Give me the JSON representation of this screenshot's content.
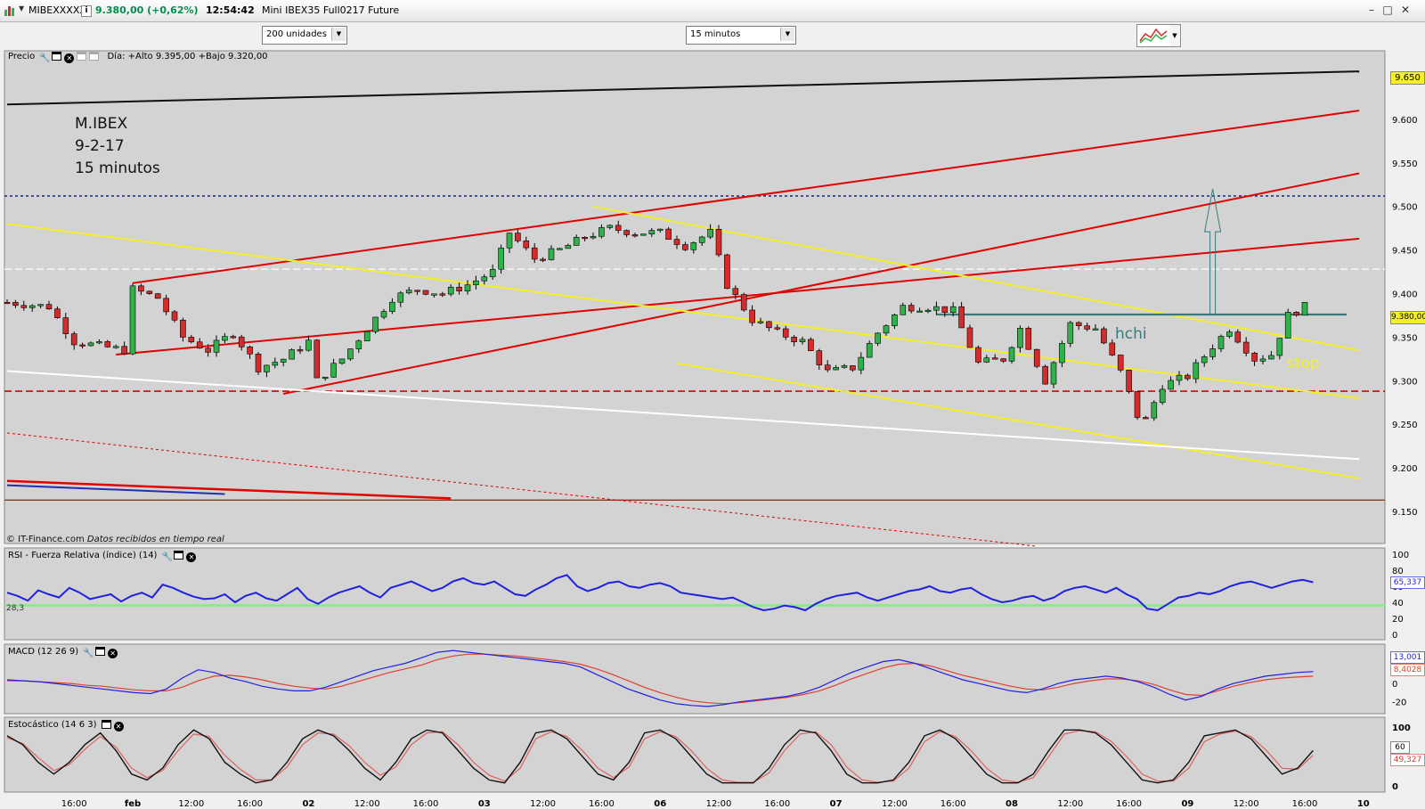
{
  "window": {
    "symbol": "MIBEXXXXX",
    "info_label": "i",
    "price_change": "9.380,00 (+0,62%)",
    "time": "12:54:42",
    "description": "Mini IBEX35 Full0217 Future"
  },
  "toolbar": {
    "units_value": "200 unidades",
    "interval_value": "15 minutos"
  },
  "price_panel": {
    "label": "Precio",
    "ohlc_text": "Día: +Alto 9.395,00 +Bajo 9.320,00",
    "annotation_lines": [
      "M.IBEX",
      "9-2-17",
      "15 minutos"
    ],
    "hchi_label": "hchi",
    "stop_label": "stop",
    "copyright": "© IT-Finance.com",
    "realtime_note": "Datos recibidos en tiempo real",
    "last_price_tag": "9.380,00",
    "top_price_tag": "9.650"
  },
  "rsi_panel": {
    "label": "RSI - Fuerza Relativa (índice) (14)",
    "min_value_label": "28,3",
    "value_tag": "65,337"
  },
  "macd_panel": {
    "label": "MACD (12 26 9)",
    "value_tag_1": "13,001",
    "value_tag_2": "8,4028"
  },
  "stoch_panel": {
    "label": "Estocástico (14 6 3)",
    "value_tag_1": "60",
    "value_tag_2": "49,327"
  },
  "colors": {
    "bull": "#2fb24a",
    "bear": "#d62b2b",
    "channel": "#e10000",
    "trend_yellow": "#f4ef2a",
    "rsi": "#2020e0",
    "macd": "#2020e0",
    "signal": "#e04030",
    "hchi_line": "#3b7a7a",
    "panel_bg": "#d3d3d3"
  },
  "chart_data": [
    {
      "type": "candlestick",
      "ylim": [
        9150,
        9650
      ],
      "y_ticks": [
        "9.650",
        "9.600",
        "9.550",
        "9.500",
        "9.450",
        "9.400",
        "9.350",
        "9.300",
        "9.250",
        "9.200",
        "9.150"
      ],
      "y_tick_values": [
        9650,
        9600,
        9550,
        9500,
        9450,
        9400,
        9350,
        9300,
        9250,
        9200,
        9150
      ],
      "x_ticks": [
        "16:00",
        "feb",
        "12:00",
        "16:00",
        "02",
        "12:00",
        "16:00",
        "03",
        "12:00",
        "16:00",
        "06",
        "12:00",
        "16:00",
        "07",
        "12:00",
        "16:00",
        "08",
        "12:00",
        "16:00",
        "09",
        "12:00",
        "16:00",
        "10"
      ],
      "x_tick_bars": [
        8,
        15,
        22,
        29,
        36,
        43,
        50,
        57,
        64,
        71,
        78,
        85,
        92,
        99,
        106,
        113,
        120,
        127,
        134,
        141,
        148,
        155,
        162
      ],
      "n_bars": 165,
      "path_points": [
        [
          0,
          9390
        ],
        [
          5,
          9385
        ],
        [
          8,
          9345
        ],
        [
          11,
          9340
        ],
        [
          14,
          9335
        ],
        [
          15,
          9405
        ],
        [
          18,
          9395
        ],
        [
          21,
          9350
        ],
        [
          24,
          9335
        ],
        [
          27,
          9355
        ],
        [
          30,
          9315
        ],
        [
          33,
          9325
        ],
        [
          36,
          9345
        ],
        [
          37,
          9300
        ],
        [
          40,
          9325
        ],
        [
          43,
          9360
        ],
        [
          46,
          9395
        ],
        [
          49,
          9405
        ],
        [
          52,
          9400
        ],
        [
          55,
          9410
        ],
        [
          58,
          9425
        ],
        [
          60,
          9470
        ],
        [
          63,
          9440
        ],
        [
          66,
          9450
        ],
        [
          69,
          9465
        ],
        [
          72,
          9475
        ],
        [
          75,
          9470
        ],
        [
          78,
          9470
        ],
        [
          81,
          9455
        ],
        [
          84,
          9470
        ],
        [
          86,
          9410
        ],
        [
          89,
          9370
        ],
        [
          92,
          9355
        ],
        [
          95,
          9345
        ],
        [
          98,
          9310
        ],
        [
          101,
          9315
        ],
        [
          104,
          9355
        ],
        [
          107,
          9385
        ],
        [
          110,
          9385
        ],
        [
          113,
          9380
        ],
        [
          116,
          9320
        ],
        [
          119,
          9325
        ],
        [
          121,
          9360
        ],
        [
          124,
          9300
        ],
        [
          127,
          9365
        ],
        [
          130,
          9360
        ],
        [
          133,
          9310
        ],
        [
          135,
          9260
        ],
        [
          136,
          9255
        ],
        [
          138,
          9295
        ],
        [
          141,
          9305
        ],
        [
          144,
          9340
        ],
        [
          146,
          9360
        ],
        [
          149,
          9325
        ],
        [
          151,
          9330
        ],
        [
          153,
          9375
        ],
        [
          155,
          9385
        ]
      ],
      "hlines": [
        {
          "value": 9512,
          "style": "blue-dotted"
        },
        {
          "value": 9288,
          "style": "red-dashed"
        },
        {
          "value": 9428,
          "style": "white-dashed"
        },
        {
          "value": 9163,
          "style": "brown"
        }
      ],
      "hchi_level": 9376,
      "target_arrow": {
        "from": 9376,
        "to": 9520
      }
    },
    {
      "type": "line",
      "name_label": "RSI",
      "ylim": [
        0,
        100
      ],
      "y_ticks": [
        "100",
        "80",
        "60",
        "40",
        "20",
        "0"
      ],
      "y_tick_values": [
        100,
        80,
        60,
        40,
        20,
        0
      ],
      "reference_level": 28.3,
      "values": [
        52,
        48,
        42,
        55,
        50,
        46,
        58,
        52,
        44,
        47,
        50,
        41,
        48,
        52,
        46,
        62,
        58,
        52,
        47,
        44,
        45,
        50,
        40,
        48,
        52,
        45,
        42,
        50,
        58,
        44,
        38,
        46,
        52,
        56,
        60,
        52,
        46,
        58,
        62,
        66,
        60,
        54,
        58,
        66,
        70,
        64,
        62,
        66,
        58,
        50,
        48,
        56,
        62,
        70,
        74,
        60,
        54,
        58,
        64,
        66,
        60,
        58,
        62,
        64,
        60,
        52,
        50,
        48,
        46,
        44,
        46,
        40,
        34,
        30,
        32,
        36,
        34,
        30,
        38,
        44,
        48,
        50,
        52,
        46,
        42,
        46,
        50,
        54,
        56,
        60,
        54,
        52,
        56,
        58,
        50,
        44,
        40,
        42,
        46,
        48,
        42,
        46,
        54,
        58,
        60,
        56,
        52,
        58,
        50,
        44,
        32,
        30,
        38,
        46,
        48,
        52,
        50,
        54,
        60,
        64,
        66,
        62,
        58,
        62,
        66,
        68,
        65
      ]
    },
    {
      "type": "line",
      "name_label": "MACD",
      "ylim": [
        -30,
        40
      ],
      "y_ticks": [
        "20",
        "0",
        "-20"
      ],
      "y_tick_values": [
        20,
        0,
        -20
      ],
      "series": [
        {
          "values": [
            4,
            3,
            2,
            0,
            -2,
            -4,
            -6,
            -8,
            -10,
            -11,
            -6,
            6,
            15,
            12,
            6,
            2,
            -3,
            -6,
            -8,
            -8,
            -4,
            2,
            8,
            14,
            18,
            22,
            28,
            34,
            36,
            34,
            32,
            30,
            28,
            26,
            24,
            22,
            18,
            10,
            2,
            -6,
            -12,
            -18,
            -22,
            -24,
            -25,
            -23,
            -20,
            -18,
            -16,
            -14,
            -10,
            -4,
            4,
            12,
            18,
            24,
            26,
            22,
            16,
            10,
            4,
            0,
            -4,
            -8,
            -10,
            -6,
            0,
            4,
            6,
            8,
            6,
            2,
            -4,
            -12,
            -18,
            -14,
            -6,
            0,
            4,
            8,
            10,
            12,
            13
          ]
        },
        {
          "values": [
            3,
            3,
            2,
            1,
            0,
            -2,
            -3,
            -5,
            -7,
            -8,
            -8,
            -4,
            3,
            8,
            9,
            7,
            4,
            0,
            -3,
            -5,
            -6,
            -3,
            2,
            7,
            12,
            16,
            20,
            26,
            30,
            32,
            32,
            31,
            30,
            28,
            26,
            24,
            21,
            16,
            10,
            3,
            -4,
            -10,
            -15,
            -19,
            -21,
            -22,
            -21,
            -19,
            -17,
            -15,
            -12,
            -8,
            -2,
            5,
            11,
            17,
            21,
            22,
            19,
            14,
            9,
            5,
            1,
            -3,
            -6,
            -7,
            -4,
            0,
            3,
            5,
            5,
            3,
            -1,
            -7,
            -12,
            -13,
            -8,
            -3,
            1,
            4,
            6,
            7,
            8
          ]
        }
      ]
    },
    {
      "type": "line",
      "name_label": "Estocástico",
      "ylim": [
        0,
        100
      ],
      "y_ticks": [
        "100",
        "60",
        "0"
      ],
      "y_tick_values": [
        100,
        60,
        0
      ],
      "series": [
        {
          "values": [
            85,
            70,
            40,
            20,
            40,
            70,
            90,
            60,
            20,
            10,
            30,
            70,
            95,
            80,
            40,
            20,
            5,
            10,
            40,
            80,
            95,
            85,
            60,
            30,
            10,
            40,
            80,
            95,
            90,
            60,
            30,
            10,
            5,
            40,
            90,
            95,
            80,
            50,
            20,
            10,
            40,
            90,
            95,
            80,
            50,
            20,
            5,
            5,
            5,
            30,
            70,
            95,
            90,
            60,
            20,
            5,
            5,
            10,
            40,
            85,
            95,
            80,
            50,
            20,
            5,
            5,
            20,
            60,
            95,
            95,
            90,
            70,
            40,
            10,
            5,
            10,
            40,
            85,
            90,
            95,
            80,
            50,
            20,
            30,
            60
          ]
        },
        {
          "values": [
            82,
            72,
            48,
            26,
            36,
            62,
            84,
            66,
            30,
            14,
            26,
            60,
            88,
            84,
            52,
            28,
            10,
            10,
            32,
            70,
            90,
            88,
            68,
            40,
            18,
            32,
            70,
            90,
            92,
            70,
            40,
            18,
            8,
            30,
            80,
            92,
            84,
            60,
            30,
            14,
            32,
            80,
            92,
            84,
            60,
            30,
            10,
            6,
            6,
            22,
            60,
            88,
            92,
            70,
            32,
            10,
            6,
            8,
            30,
            75,
            92,
            84,
            60,
            30,
            10,
            6,
            14,
            50,
            88,
            94,
            92,
            76,
            50,
            20,
            8,
            8,
            30,
            75,
            88,
            93,
            84,
            60,
            30,
            28,
            52
          ]
        }
      ]
    }
  ]
}
